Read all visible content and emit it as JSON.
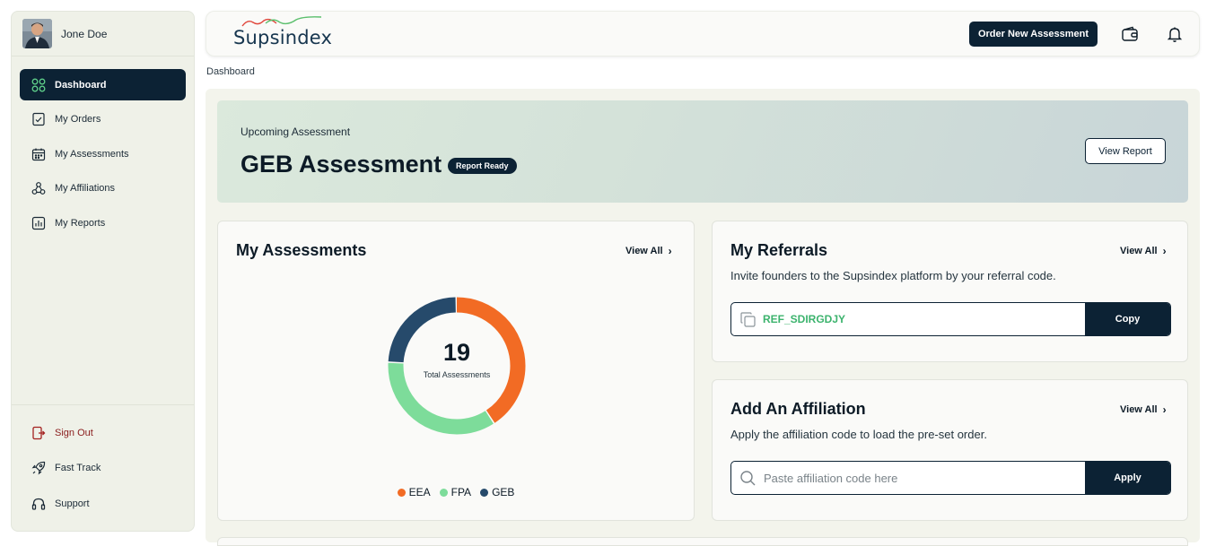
{
  "user": {
    "name": "Jone Doe"
  },
  "sidebar": {
    "items": [
      {
        "label": "Dashboard",
        "icon": "dashboard-grid-icon",
        "active": true
      },
      {
        "label": "My Orders",
        "icon": "orders-icon"
      },
      {
        "label": "My Assessments",
        "icon": "calendar-icon"
      },
      {
        "label": "My Affiliations",
        "icon": "affiliations-icon"
      },
      {
        "label": "My Reports",
        "icon": "reports-icon"
      }
    ],
    "bottom": [
      {
        "label": "Sign Out",
        "icon": "sign-out-icon"
      },
      {
        "label": "Fast Track",
        "icon": "rocket-icon"
      },
      {
        "label": "Support",
        "icon": "headset-icon"
      }
    ]
  },
  "header": {
    "logo": "Supsindex",
    "order_button": "Order New Assessment",
    "icons": [
      "wallet-icon",
      "bell-icon"
    ]
  },
  "breadcrumb": "Dashboard",
  "banner": {
    "subtitle": "Upcoming Assessment",
    "title": "GEB Assessment",
    "badge": "Report Ready",
    "button": "View Report"
  },
  "assessments": {
    "title": "My Assessments",
    "view_all": "View All",
    "total": "19",
    "total_label": "Total Assessments",
    "chart_data": {
      "type": "pie",
      "categories": [
        "EEA",
        "FPA",
        "GEB"
      ],
      "values": [
        41,
        35,
        24
      ],
      "colors": [
        "#f26b24",
        "#7ddc9a",
        "#264a6b"
      ]
    }
  },
  "referrals": {
    "title": "My Referrals",
    "view_all": "View All",
    "description": "Invite founders to the Supsindex platform by your referral code.",
    "code": "REF_SDIRGDJY",
    "button": "Copy"
  },
  "affiliation": {
    "title": "Add An Affiliation",
    "view_all": "View All",
    "description": "Apply the affiliation code to load the pre-set order.",
    "placeholder": "Paste affiliation code here",
    "button": "Apply"
  },
  "colors": {
    "primary": "#0c2234",
    "accent_green": "#3cb36d",
    "signout_red": "#8a1c1c"
  }
}
